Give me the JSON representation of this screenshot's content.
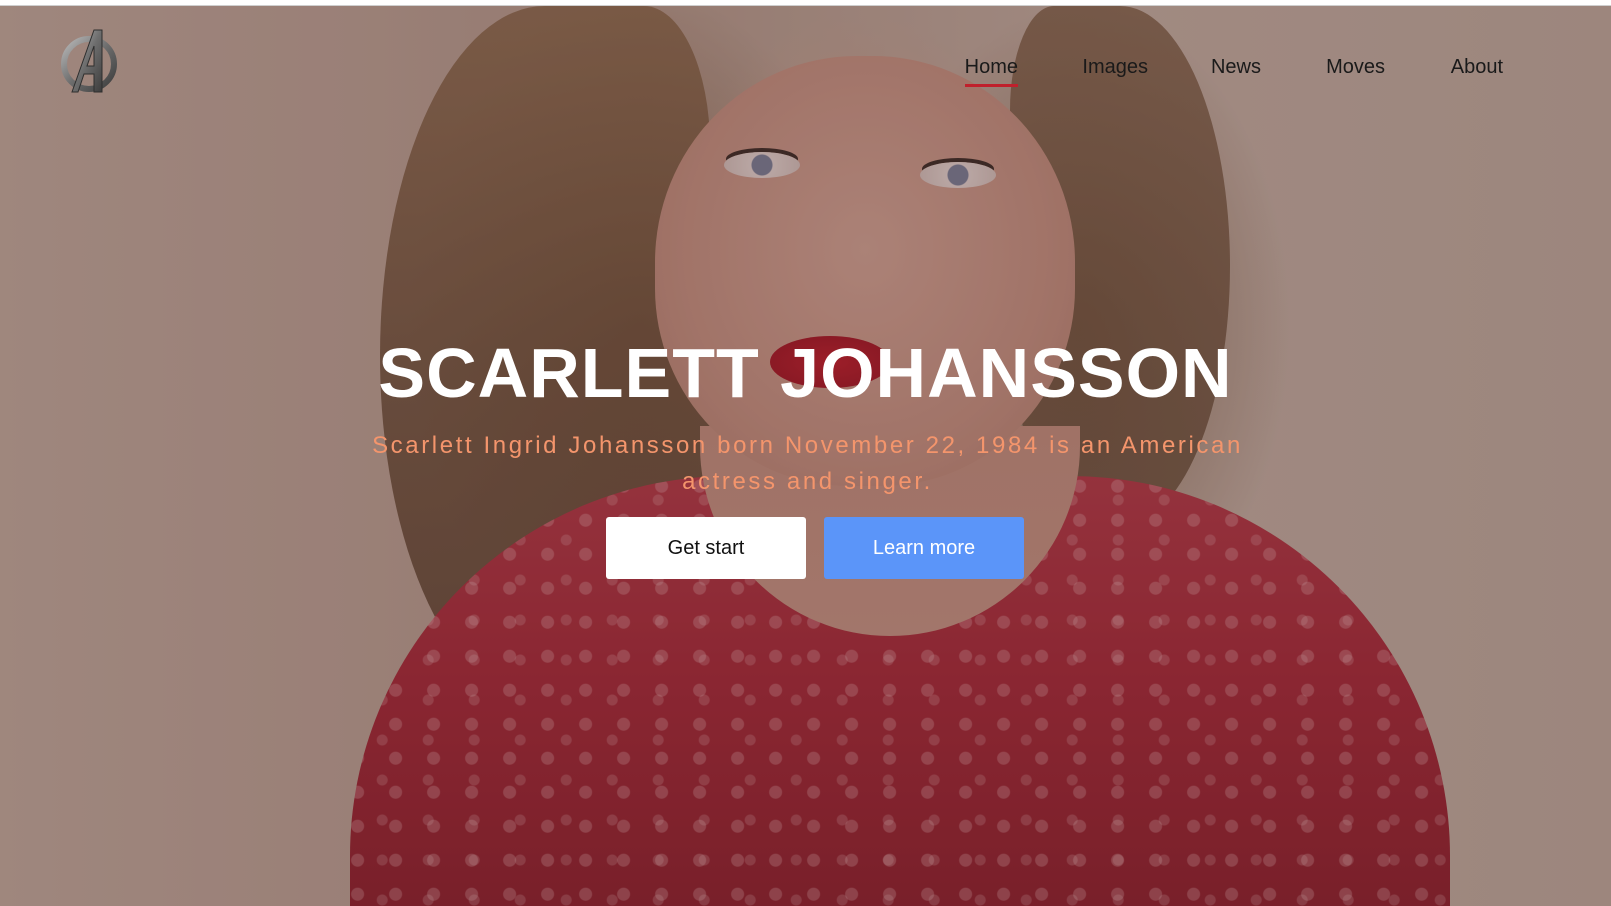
{
  "header": {
    "logo_icon": "avengers-a-logo-icon",
    "nav": [
      {
        "label": "Home",
        "active": true
      },
      {
        "label": "Images",
        "active": false
      },
      {
        "label": "News",
        "active": false
      },
      {
        "label": "Moves",
        "active": false
      },
      {
        "label": "About",
        "active": false
      }
    ]
  },
  "hero": {
    "title": "SCARLETT JOHANSSON",
    "subtitle": "Scarlett Ingrid Johansson born November 22, 1984 is an American actress and singer.",
    "buttons": {
      "get_start": "Get start",
      "learn_more": "Learn more"
    }
  },
  "colors": {
    "accent_underline": "#c0202c",
    "subtitle": "#f4956c",
    "learn_more_bg": "#5b95f9"
  }
}
